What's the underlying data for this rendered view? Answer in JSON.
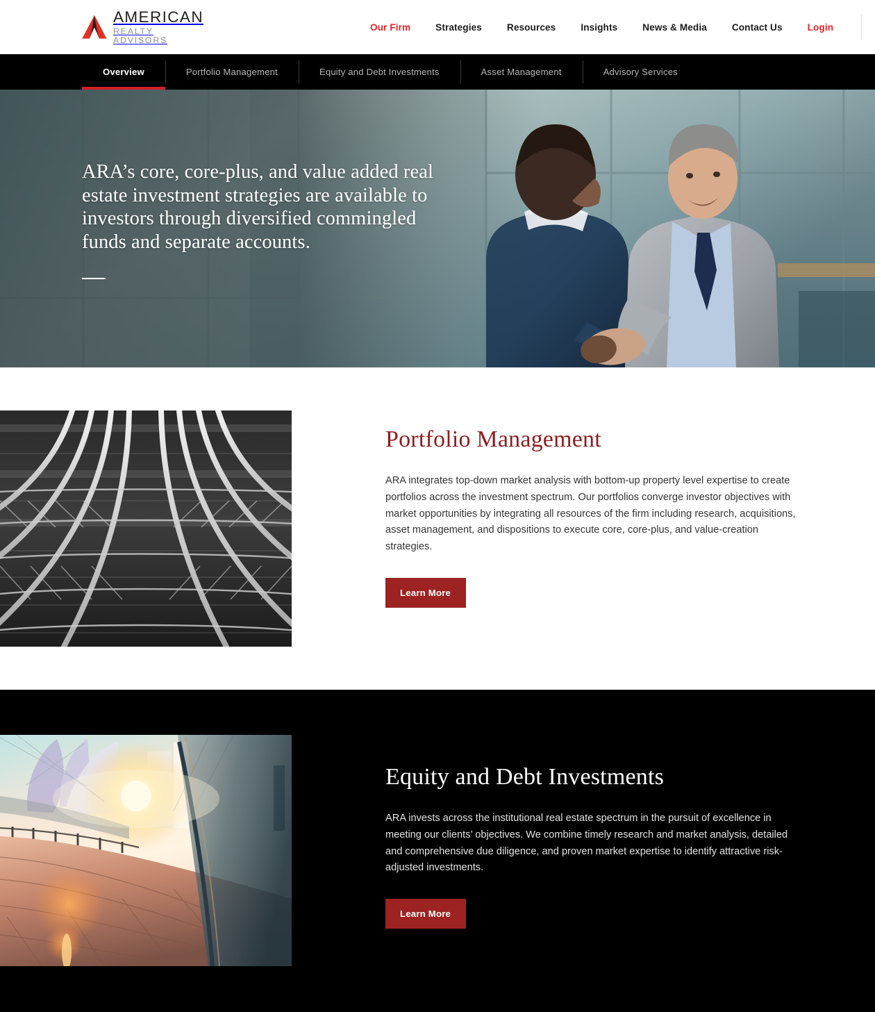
{
  "brand": {
    "logo_icon": "ara-chevron-logo-icon",
    "name_line1": "AMERICAN",
    "name_line2": "REALTY ADVISORS",
    "accent_color": "#e8232a",
    "logo_red": "#e03127",
    "logo_dark_red": "#9c2118"
  },
  "header": {
    "nav": [
      {
        "label": "Our Firm",
        "accent": true
      },
      {
        "label": "Strategies",
        "accent": false
      },
      {
        "label": "Resources",
        "accent": false
      },
      {
        "label": "Insights",
        "accent": false
      },
      {
        "label": "News & Media",
        "accent": false
      },
      {
        "label": "Contact Us",
        "accent": false
      },
      {
        "label": "Login",
        "accent": true
      }
    ],
    "search_icon": "search-icon",
    "search_color": "#e8232a"
  },
  "tabs": [
    {
      "label": "Overview",
      "active": true
    },
    {
      "label": "Portfolio Management",
      "active": false
    },
    {
      "label": "Equity and Debt Investments",
      "active": false
    },
    {
      "label": "Asset Management",
      "active": false
    },
    {
      "label": "Advisory Services",
      "active": false
    }
  ],
  "tab_active_color": "#cf2026",
  "hero": {
    "headline": "ARA’s core, core-plus, and value added real estate investment strategies are available to investors through diversified commingled funds and separate accounts.",
    "image_alt": "Two businessmen shaking hands in a modern glass office lobby"
  },
  "sections": [
    {
      "id": "portfolio-management",
      "theme": "light",
      "title": "Portfolio Management",
      "body": "ARA integrates top-down market analysis with bottom-up property level expertise to create portfolios across the investment spectrum. Our portfolios converge investor objectives with market opportunities by integrating all resources of the firm including research, acquisitions, asset management, and dispositions to execute core, core-plus, and value-creation strategies.",
      "button_label": "Learn More",
      "image_alt": "Black and white photo of fanning steel ribs under a bridge"
    },
    {
      "id": "equity-and-debt-investments",
      "theme": "dark",
      "title": "Equity and Debt Investments",
      "body": "ARA invests across the institutional real estate spectrum in the pursuit of excellence in meeting our clients’ objectives. We combine timely research and market analysis, detailed and comprehensive due diligence, and proven market expertise to identify attractive risk-adjusted investments.",
      "button_label": "Learn More",
      "image_alt": "Sunset over a modern waterfront boardwalk with glass railing and lens flare"
    }
  ],
  "colors": {
    "button_red": "#9d2222",
    "title_red": "#8f1d1d",
    "dark_bg": "#000000",
    "light_bg": "#ffffff"
  }
}
